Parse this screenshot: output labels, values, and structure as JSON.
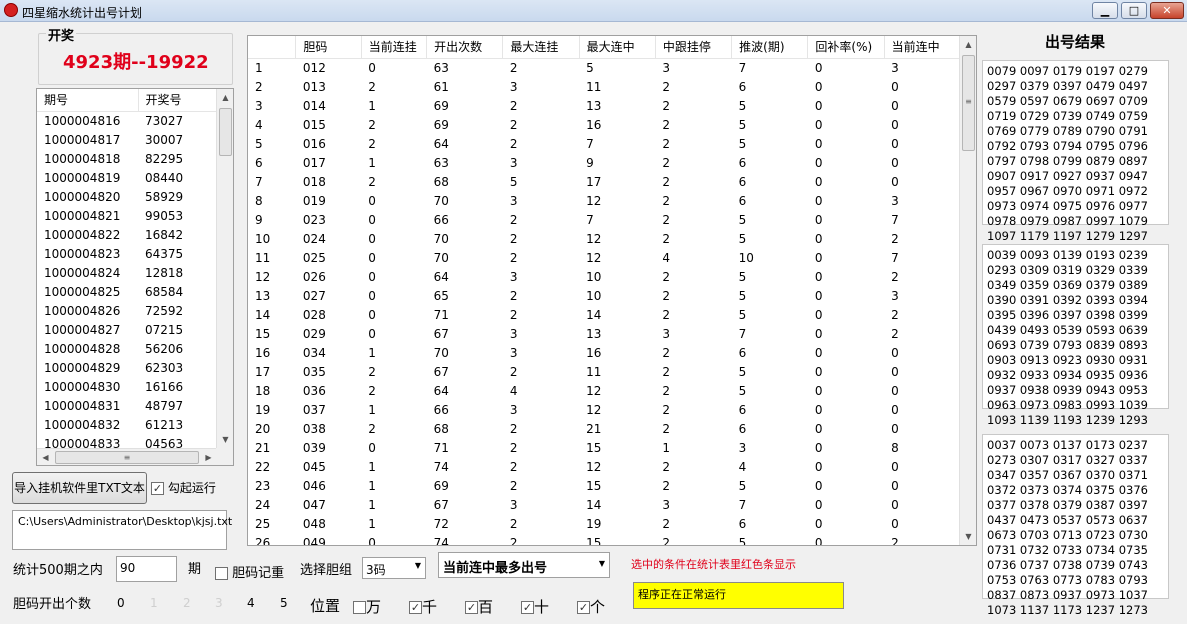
{
  "window": {
    "title": "四星缩水统计出号计划",
    "min": "▁",
    "max": "□",
    "close": "✕"
  },
  "lottery": {
    "group_label": "开奖",
    "current": "4923期--19922"
  },
  "history": {
    "headers": [
      "期号",
      "开奖号"
    ],
    "rows": [
      [
        "1000004816",
        "73027"
      ],
      [
        "1000004817",
        "30007"
      ],
      [
        "1000004818",
        "82295"
      ],
      [
        "1000004819",
        "08440"
      ],
      [
        "1000004820",
        "58929"
      ],
      [
        "1000004821",
        "99053"
      ],
      [
        "1000004822",
        "16842"
      ],
      [
        "1000004823",
        "64375"
      ],
      [
        "1000004824",
        "12818"
      ],
      [
        "1000004825",
        "68584"
      ],
      [
        "1000004826",
        "72592"
      ],
      [
        "1000004827",
        "07215"
      ],
      [
        "1000004828",
        "56206"
      ],
      [
        "1000004829",
        "62303"
      ],
      [
        "1000004830",
        "16166"
      ],
      [
        "1000004831",
        "48797"
      ],
      [
        "1000004832",
        "61213"
      ],
      [
        "1000004833",
        "04563"
      ]
    ]
  },
  "stats": {
    "headers": [
      "",
      "胆码",
      "当前连挂",
      "开出次数",
      "最大连挂",
      "最大连中",
      "中跟挂停",
      "推波(期)",
      "回补率(%)",
      "当前连中"
    ],
    "rows": [
      [
        "1",
        "012",
        "0",
        "63",
        "2",
        "5",
        "3",
        "7",
        "0",
        "3"
      ],
      [
        "2",
        "013",
        "2",
        "61",
        "3",
        "11",
        "2",
        "6",
        "0",
        "0"
      ],
      [
        "3",
        "014",
        "1",
        "69",
        "2",
        "13",
        "2",
        "5",
        "0",
        "0"
      ],
      [
        "4",
        "015",
        "2",
        "69",
        "2",
        "16",
        "2",
        "5",
        "0",
        "0"
      ],
      [
        "5",
        "016",
        "2",
        "64",
        "2",
        "7",
        "2",
        "5",
        "0",
        "0"
      ],
      [
        "6",
        "017",
        "1",
        "63",
        "3",
        "9",
        "2",
        "6",
        "0",
        "0"
      ],
      [
        "7",
        "018",
        "2",
        "68",
        "5",
        "17",
        "2",
        "6",
        "0",
        "0"
      ],
      [
        "8",
        "019",
        "0",
        "70",
        "3",
        "12",
        "2",
        "6",
        "0",
        "3"
      ],
      [
        "9",
        "023",
        "0",
        "66",
        "2",
        "7",
        "2",
        "5",
        "0",
        "7"
      ],
      [
        "10",
        "024",
        "0",
        "70",
        "2",
        "12",
        "2",
        "5",
        "0",
        "2"
      ],
      [
        "11",
        "025",
        "0",
        "70",
        "2",
        "12",
        "4",
        "10",
        "0",
        "7"
      ],
      [
        "12",
        "026",
        "0",
        "64",
        "3",
        "10",
        "2",
        "5",
        "0",
        "2"
      ],
      [
        "13",
        "027",
        "0",
        "65",
        "2",
        "10",
        "2",
        "5",
        "0",
        "3"
      ],
      [
        "14",
        "028",
        "0",
        "71",
        "2",
        "14",
        "2",
        "5",
        "0",
        "2"
      ],
      [
        "15",
        "029",
        "0",
        "67",
        "3",
        "13",
        "3",
        "7",
        "0",
        "2"
      ],
      [
        "16",
        "034",
        "1",
        "70",
        "3",
        "16",
        "2",
        "6",
        "0",
        "0"
      ],
      [
        "17",
        "035",
        "2",
        "67",
        "2",
        "11",
        "2",
        "5",
        "0",
        "0"
      ],
      [
        "18",
        "036",
        "2",
        "64",
        "4",
        "12",
        "2",
        "5",
        "0",
        "0"
      ],
      [
        "19",
        "037",
        "1",
        "66",
        "3",
        "12",
        "2",
        "6",
        "0",
        "0"
      ],
      [
        "20",
        "038",
        "2",
        "68",
        "2",
        "21",
        "2",
        "6",
        "0",
        "0"
      ],
      [
        "21",
        "039",
        "0",
        "71",
        "2",
        "15",
        "1",
        "3",
        "0",
        "8"
      ],
      [
        "22",
        "045",
        "1",
        "74",
        "2",
        "12",
        "2",
        "4",
        "0",
        "0"
      ],
      [
        "23",
        "046",
        "1",
        "69",
        "2",
        "15",
        "2",
        "5",
        "0",
        "0"
      ],
      [
        "24",
        "047",
        "1",
        "67",
        "3",
        "14",
        "3",
        "7",
        "0",
        "0"
      ],
      [
        "25",
        "048",
        "1",
        "72",
        "2",
        "19",
        "2",
        "6",
        "0",
        "0"
      ],
      [
        "26",
        "049",
        "0",
        "74",
        "2",
        "15",
        "2",
        "5",
        "0",
        "2"
      ]
    ]
  },
  "results": {
    "title": "出号结果",
    "box1": "0079 0097 0179 0197 0279 0297 0379 0397 0479 0497 0579 0597 0679 0697 0709 0719 0729 0739 0749 0759 0769 0779 0789 0790 0791 0792 0793 0794 0795 0796 0797 0798 0799 0879 0897 0907 0917 0927 0937 0947 0957 0967 0970 0971 0972 0973 0974 0975 0976 0977 0978 0979 0987 0997 1079 1097 1179 1197 1279 1297",
    "box2": "0039 0093 0139 0193 0239 0293 0309 0319 0329 0339 0349 0359 0369 0379 0389 0390 0391 0392 0393 0394 0395 0396 0397 0398 0399 0439 0493 0539 0593 0639 0693 0739 0793 0839 0893 0903 0913 0923 0930 0931 0932 0933 0934 0935 0936 0937 0938 0939 0943 0953 0963 0973 0983 0993 1039 1093 1139 1193 1239 1293",
    "box3": "0037 0073 0137 0173 0237 0273 0307 0317 0327 0337 0347 0357 0367 0370 0371 0372 0373 0374 0375 0376 0377 0378 0379 0387 0397 0437 0473 0537 0573 0637 0673 0703 0713 0723 0730 0731 0732 0733 0734 0735 0736 0737 0738 0739 0743 0753 0763 0773 0783 0793 0837 0873 0937 0973 1037 1073 1137 1173 1237 1273"
  },
  "controls": {
    "import_button": "导入挂机软件里TXT文本",
    "auto_run_label": "勾起运行",
    "auto_run_check": "✓",
    "file_path": "C:\\Users\\Administrator\\Desktop\\kjsj.txt",
    "stat_prefix": "统计500期之内",
    "stat_value": "90",
    "stat_suffix": "期",
    "dan_memo_label": "胆码记重",
    "select_group_label": "选择胆组",
    "group_select": "3码",
    "mode_select": "当前连中最多出号",
    "hint": "选中的条件在统计表里红色条显示",
    "status": "程序正在正常运行",
    "dan_count_label": "胆码开出个数",
    "dan_counts": [
      "0",
      "1",
      "2",
      "3",
      "4",
      "5"
    ],
    "position_label": "位置",
    "positions": [
      {
        "label": "万",
        "checked": ""
      },
      {
        "label": "千",
        "checked": "✓"
      },
      {
        "label": "百",
        "checked": "✓"
      },
      {
        "label": "十",
        "checked": "✓"
      },
      {
        "label": "个",
        "checked": "✓"
      }
    ]
  },
  "colors": {
    "accent_red": "#e0001a",
    "status_bg": "#ffff00"
  }
}
